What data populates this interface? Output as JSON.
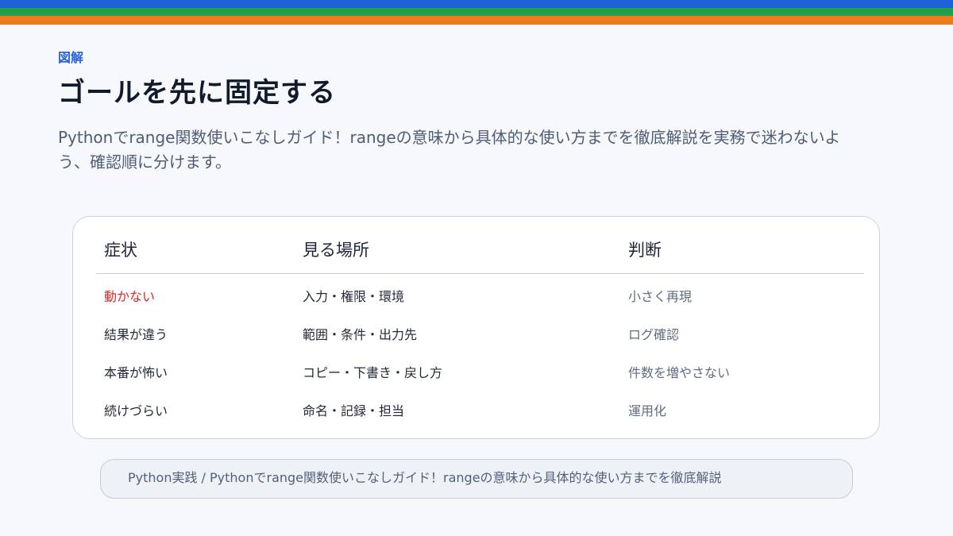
{
  "colors": {
    "stripe_blue": "#1f5fd8",
    "stripe_green": "#22a04a",
    "stripe_orange": "#f07a1c",
    "accent": "#2a64d6",
    "alert": "#d42a2a"
  },
  "header": {
    "eyebrow": "図解",
    "title": "ゴールを先に固定する",
    "subtitle": "Pythonでrange関数使いこなしガイド！rangeの意味から具体的な使い方までを徹底解説を実務で迷わないよう、確認順に分けます。"
  },
  "table": {
    "headers": [
      "症状",
      "見る場所",
      "判断"
    ],
    "rows": [
      {
        "symptom": "動かない",
        "where": "入力・権限・環境",
        "decision": "小さく再現"
      },
      {
        "symptom": "結果が違う",
        "where": "範囲・条件・出力先",
        "decision": "ログ確認"
      },
      {
        "symptom": "本番が怖い",
        "where": "コピー・下書き・戻し方",
        "decision": "件数を増やさない"
      },
      {
        "symptom": "続けづらい",
        "where": "命名・記録・担当",
        "decision": "運用化"
      }
    ]
  },
  "footer": {
    "text": "Python実践 / Pythonでrange関数使いこなしガイド！rangeの意味から具体的な使い方までを徹底解説"
  }
}
